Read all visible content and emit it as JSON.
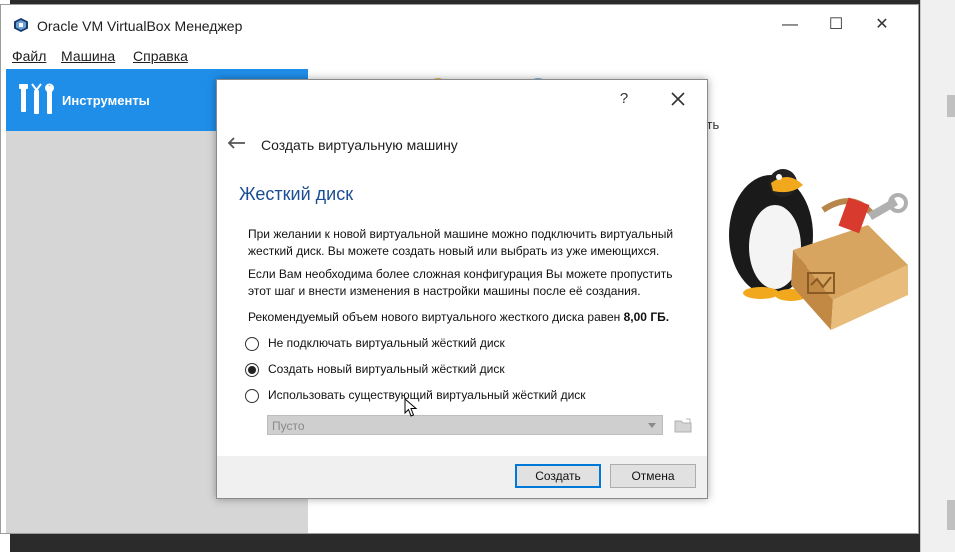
{
  "window": {
    "title": "Oracle VM VirtualBox Менеджер",
    "controls": {
      "minimize": "—",
      "maximize": "☐",
      "close": "✕"
    }
  },
  "menu": [
    "Файл",
    "Машина",
    "Справка"
  ],
  "sidebar": {
    "tools_label": "Инструменты"
  },
  "right_pane": {
    "partial_text": "сть"
  },
  "dialog": {
    "help": "?",
    "header_title": "Создать виртуальную машину",
    "section_title": "Жесткий диск",
    "paragraph1": "При желании к новой виртуальной машине можно подключить виртуальный жесткий диск. Вы можете создать новый или выбрать из уже имеющихся.",
    "paragraph2": "Если Вам необходима более сложная конфигурация Вы можете пропустить этот шаг и внести изменения в настройки машины после её создания.",
    "paragraph3_prefix": "Рекомендуемый объем нового виртуального жесткого диска равен",
    "paragraph3_value": "8,00 ГБ.",
    "options": [
      {
        "label": "Не подключать виртуальный жёсткий диск",
        "checked": false
      },
      {
        "label": "Создать новый виртуальный жёсткий диск",
        "checked": true
      },
      {
        "label": "Использовать существующий виртуальный жёсткий диск",
        "checked": false
      }
    ],
    "combo_value": "Пусто",
    "buttons": {
      "create": "Создать",
      "cancel": "Отмена"
    }
  },
  "colors": {
    "accent": "#1f8ee8",
    "section_title": "#1a4e93",
    "default_button_border": "#0078d7"
  }
}
